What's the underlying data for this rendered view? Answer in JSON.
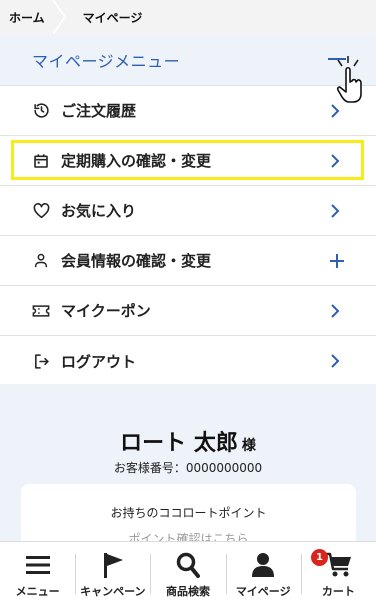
{
  "breadcrumb": {
    "home": "ホーム",
    "current": "マイページ"
  },
  "menu": {
    "title": "マイページメニュー",
    "items": [
      {
        "label": "ご注文履歴",
        "icon": "history-icon",
        "action": "chevron"
      },
      {
        "label": "定期購入の確認・変更",
        "icon": "calendar-icon",
        "action": "chevron"
      },
      {
        "label": "お気に入り",
        "icon": "heart-icon",
        "action": "chevron"
      },
      {
        "label": "会員情報の確認・変更",
        "icon": "person-icon",
        "action": "plus"
      },
      {
        "label": "マイクーポン",
        "icon": "coupon-icon",
        "action": "chevron"
      },
      {
        "label": "ログアウト",
        "icon": "logout-icon",
        "action": "chevron"
      }
    ]
  },
  "profile": {
    "name": "ロート 太郎",
    "honorific": "様",
    "customer_number": "お客様番号：0000000000",
    "point_card_label": "お持ちのココロートポイント",
    "point_card_sub": "ポイント確認はこちら"
  },
  "bottom_nav": {
    "items": [
      {
        "label": "メニュー",
        "icon": "hamburger-icon"
      },
      {
        "label": "キャンペーン",
        "icon": "flag-icon"
      },
      {
        "label": "商品検索",
        "icon": "search-icon"
      },
      {
        "label": "マイページ",
        "icon": "person-icon"
      },
      {
        "label": "カート",
        "icon": "cart-icon"
      }
    ],
    "cart_badge": "1"
  },
  "colors": {
    "accent": "#2f5fb3",
    "highlight": "#f5ec1a",
    "badge": "#d9261c",
    "panel": "#eef2f9"
  }
}
